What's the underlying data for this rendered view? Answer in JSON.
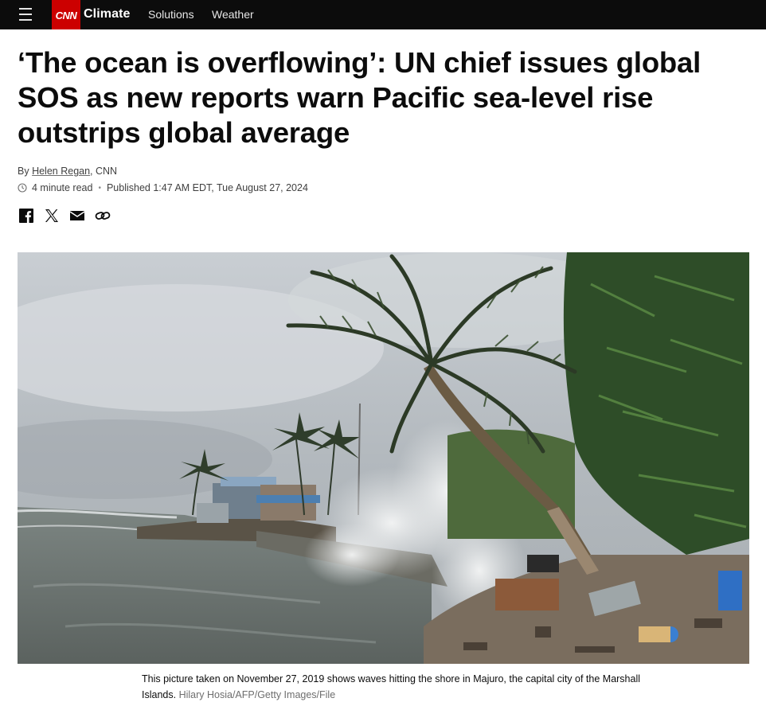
{
  "nav": {
    "section": "Climate",
    "links": [
      "Solutions",
      "Weather"
    ],
    "brand": "CNN"
  },
  "article": {
    "headline": "‘The ocean is overflowing’: UN chief issues global SOS as new reports warn Pacific sea-level rise outstrips global average",
    "byline_prefix": "By",
    "author": "Helen Regan",
    "outlet": ", CNN",
    "read_time": "4 minute read",
    "published": "Published 1:47 AM EDT, Tue August 27, 2024"
  },
  "share": {
    "icons": [
      "facebook-icon",
      "x-icon",
      "email-icon",
      "link-icon"
    ]
  },
  "image": {
    "caption": "This picture taken on November 27, 2019 shows waves hitting the shore in Majuro, the capital city of the Marshall Islands.",
    "credit": "Hilary Hosia/AFP/Getty Images/File"
  },
  "colors": {
    "topbar": "#0c0c0c",
    "brand_red": "#cc0000",
    "text": "#0c0c0c",
    "muted": "#6e6e6e"
  }
}
